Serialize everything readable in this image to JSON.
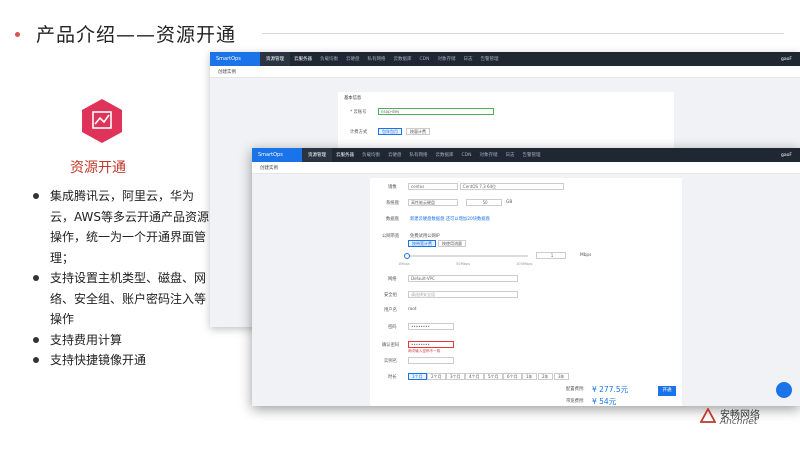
{
  "slide": {
    "title": "产品介绍——资源开通",
    "feature_title": "资源开通",
    "bullets": [
      "集成腾讯云，阿里云，华为云，AWS等多云开通产品资源操作，统一为一个开通界面管理；",
      "支持设置主机类型、磁盘、网络、安全组、账户密码注入等操作",
      "支持费用计算",
      "支持快捷镜像开通"
    ],
    "logo_cn": "安畅网络",
    "logo_en": "Anchnet"
  },
  "app": {
    "brand": "SmartOps",
    "menu": "资源管理",
    "user": "gaoF",
    "nav": [
      "云服务器",
      "负载均衡",
      "云硬盘",
      "私有网络",
      "云数据库",
      "CDN",
      "对象存储",
      "日志",
      "告警管理"
    ],
    "page_title": "创建实例"
  },
  "back_form": {
    "section": "基本信息",
    "account_label": "* 云账号",
    "account_value": "nsop-dev",
    "billing_label": "计费方式",
    "billing_options": [
      "包年包月",
      "按量计费"
    ]
  },
  "front_form": {
    "image_label": "镜像",
    "image_type": "centos",
    "image_value": "CentOS 7.3 64位",
    "disk_label": "系统盘",
    "disk_type": "高性能云硬盘",
    "disk_size": "50",
    "disk_unit": "GB",
    "datadisk_label": "数据盘",
    "datadisk_text": "新建云硬盘数据盘 还可以增加20块数据盘",
    "bandwidth_label": "公网带宽",
    "bandwidth_check": "免费试用公网IP",
    "bandwidth_options": [
      "按带宽计费",
      "按使用流量"
    ],
    "bandwidth_value": "1",
    "bandwidth_unit": "Mbps",
    "slider_ticks": [
      "1Mbps",
      "50Mbps",
      "100Mbps"
    ],
    "network_label": "网络",
    "network_value": "Default-VPC",
    "security_label": "安全组",
    "security_value": "请选择安全组",
    "username_label": "用户名",
    "username_value": "root",
    "password_label": "密码",
    "password_value": "••••••••",
    "confirm_label": "确认密码",
    "confirm_value": "••••••••",
    "confirm_error": "两次输入密码不一致",
    "instance_label": "实例名",
    "duration_label": "时长",
    "durations": [
      "1个月",
      "2个月",
      "3个月",
      "4个月",
      "5个月",
      "6个月",
      "1年",
      "2年",
      "3年"
    ],
    "config_fee_label": "配置费用:",
    "config_fee": "¥ 277.5元",
    "bw_fee_label": "带宽费用:",
    "bw_fee": "¥ 54元",
    "create_btn": "开通"
  }
}
